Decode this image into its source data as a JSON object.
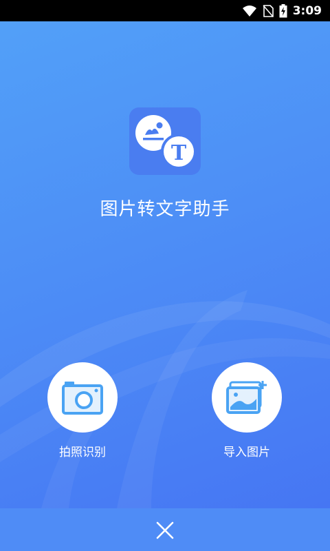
{
  "status_bar": {
    "time": "3:09",
    "icons": [
      "wifi-icon",
      "no-sim-icon",
      "battery-charging-icon"
    ]
  },
  "app": {
    "title": "图片转文字助手",
    "logo_letter": "T",
    "logo_icon": "image-to-text-icon"
  },
  "actions": [
    {
      "label": "拍照识别",
      "icon": "camera-icon"
    },
    {
      "label": "导入图片",
      "icon": "image-add-icon"
    }
  ],
  "bottom_bar": {
    "close_icon": "close-icon"
  },
  "colors": {
    "background_top": "#52a0f8",
    "background_bottom": "#4676f3",
    "accent": "#4aa3f3",
    "bottom_bar": "#4f8cf6"
  }
}
